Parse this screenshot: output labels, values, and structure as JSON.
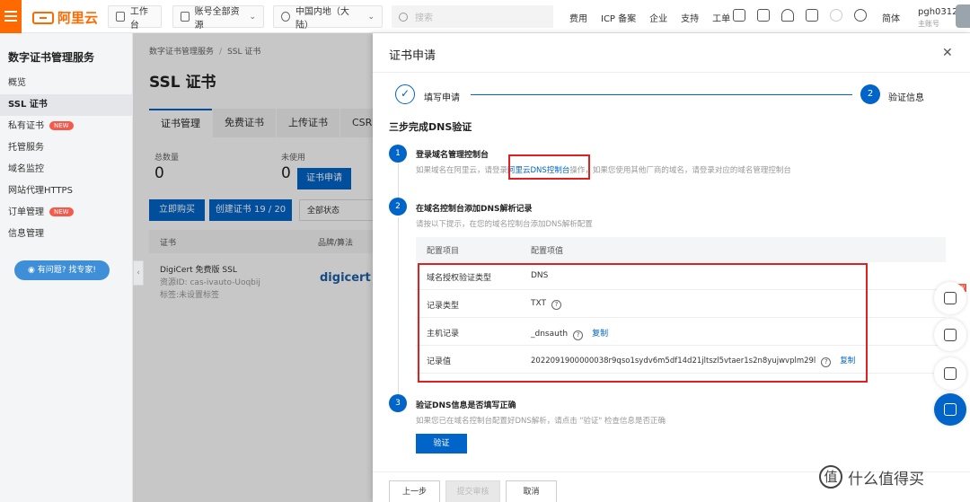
{
  "topbar": {
    "logo_text": "阿里云",
    "workbench": "工作台",
    "account_resources": "账号全部资源",
    "region": "中国内地（大陆）",
    "search_placeholder": "搜索",
    "links": [
      "费用",
      "ICP 备案",
      "企业",
      "支持",
      "工单"
    ],
    "lang": "简体",
    "username": "pgh0312",
    "account_type": "主账号"
  },
  "sidebar": {
    "title": "数字证书管理服务",
    "items": [
      {
        "label": "概览"
      },
      {
        "label": "SSL 证书"
      },
      {
        "label": "私有证书",
        "badge": "NEW"
      },
      {
        "label": "托管服务"
      },
      {
        "label": "域名监控"
      },
      {
        "label": "网站代理HTTPS"
      },
      {
        "label": "订单管理",
        "badge": "NEW"
      },
      {
        "label": "信息管理"
      }
    ],
    "help_button": "有问题? 找专家!"
  },
  "main": {
    "breadcrumb": [
      "数字证书管理服务",
      "SSL 证书"
    ],
    "page_title": "SSL 证书",
    "tabs": [
      "证书管理",
      "免费证书",
      "上传证书",
      "CSR管"
    ],
    "stats": [
      {
        "label": "总数量",
        "value": "0"
      },
      {
        "label": "未使用",
        "value": "0"
      }
    ],
    "apply_button": "证书申请",
    "buy_button": "立即购买",
    "create_button": "创建证书 19 / 20",
    "status_select": "全部状态",
    "table_headers": [
      "证书",
      "品牌/算法"
    ],
    "row": {
      "name": "DigiCert 免费版 SSL",
      "resource_id": "资源ID: cas-ivauto-Uoqbij",
      "tag": "标签:未设置标签",
      "brand": "digicert"
    }
  },
  "drawer": {
    "title": "证书申请",
    "steps": [
      {
        "label": "填写申请"
      },
      {
        "number": "2",
        "label": "验证信息"
      }
    ],
    "heading": "三步完成DNS验证",
    "step1": {
      "number": "1",
      "title": "登录域名管理控制台",
      "desc_prefix": "如果域名在阿里云，请登录",
      "desc_link": "阿里云DNS控制台",
      "desc_suffix": "操作，如果您使用其他厂商的域名，请登录对应的域名管理控制台"
    },
    "step2": {
      "number": "2",
      "title": "在域名控制台添加DNS解析记录",
      "desc": "请按以下提示，在您的域名控制台添加DNS解析配置",
      "table_head": {
        "key": "配置项目",
        "value": "配置项值"
      },
      "rows": [
        {
          "key": "域名授权验证类型",
          "value": "DNS"
        },
        {
          "key": "记录类型",
          "value": "TXT"
        },
        {
          "key": "主机记录",
          "value": "_dnsauth",
          "copy": "复制"
        },
        {
          "key": "记录值",
          "value": "2022091900000038r9qso1sydv6m5df14d21jltszl5vtaer1s2n8yujwvplm29l",
          "copy": "复制"
        }
      ]
    },
    "step3": {
      "number": "3",
      "title": "验证DNS信息是否填写正确",
      "desc": "如果您已在域名控制台配置好DNS解析，请点击 \"验证\" 检查信息是否正确",
      "verify_button": "验证"
    },
    "footer": {
      "prev": "上一步",
      "submit": "提交审核",
      "cancel": "取消"
    }
  },
  "float": {
    "new_tag": "NEW"
  },
  "watermark": {
    "symbol": "值",
    "text": "什么值得买"
  },
  "colors": {
    "brand": "#ff6a00",
    "primary": "#0064c8",
    "highlight": "#e02020"
  }
}
